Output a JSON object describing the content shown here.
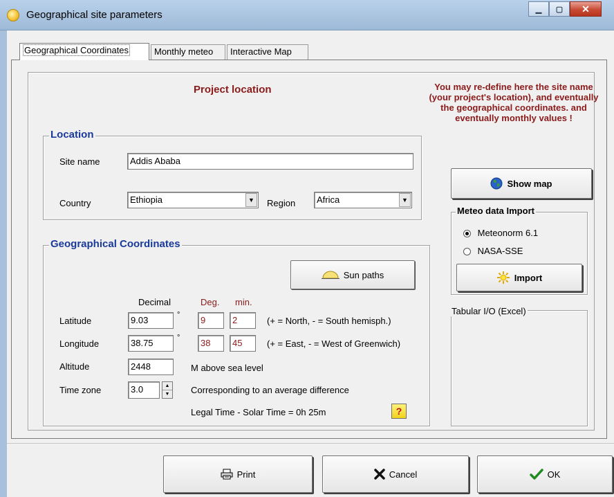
{
  "window": {
    "title": "Geographical site parameters",
    "min": "▁",
    "max": "▢",
    "close": "✕"
  },
  "tabs": [
    {
      "label": "Geographical Coordinates",
      "active": true
    },
    {
      "label": "Monthly meteo",
      "active": false
    },
    {
      "label": "Interactive Map",
      "active": false
    }
  ],
  "project_location": "Project location",
  "info_text": "You may re-define here the site name (your project's location),  and eventually the geographical coordinates. and eventually monthly values !",
  "location": {
    "group_title": "Location",
    "site_name_label": "Site name",
    "site_name": "Addis Ababa",
    "country_label": "Country",
    "country": "Ethiopia",
    "region_label": "Region",
    "region": "Africa"
  },
  "geo": {
    "group_title": "Geographical Coordinates",
    "sun_paths": "Sun paths",
    "decimal_header": "Decimal",
    "deg_header": "Deg.",
    "min_header": "min.",
    "latitude_label": "Latitude",
    "latitude": "9.03",
    "lat_deg": "9",
    "lat_min": "2",
    "lat_note": "(+ = North,  - = South hemisph.)",
    "longitude_label": "Longitude",
    "longitude": "38.75",
    "lon_deg": "38",
    "lon_min": "45",
    "lon_note": "(+ = East, - = West of Greenwich)",
    "degree_mark": "°",
    "altitude_label": "Altitude",
    "altitude": "2448",
    "altitude_unit": "M above sea level",
    "timezone_label": "Time zone",
    "timezone": "3.0",
    "timezone_note": "Corresponding to an average difference",
    "legal_time": "Legal Time - Solar Time =   0h 25m",
    "help": "?"
  },
  "show_map": "Show map",
  "meteo_import": {
    "group_title": "Meteo data Import",
    "options": [
      "Meteonorm 6.1",
      "NASA-SSE"
    ],
    "selected": 0,
    "import_button": "Import"
  },
  "tabular": {
    "group_title": "Tabular I/O (Excel)"
  },
  "footer": {
    "print": "Print",
    "cancel": "Cancel",
    "ok": "OK"
  },
  "colors": {
    "title_red": "#8b1a1a",
    "group_blue": "#1a3a9a"
  }
}
